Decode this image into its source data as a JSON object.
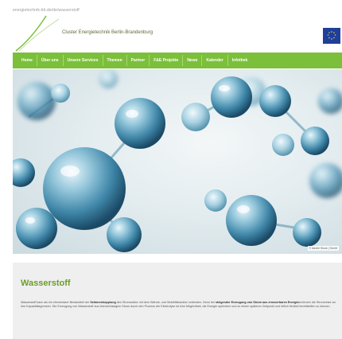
{
  "browser": {
    "url": "energietechnik-bb.de/de/wasserstoff"
  },
  "header": {
    "site_title": "Cluster Energietechnik Berlin-Brandenburg"
  },
  "nav": {
    "items": [
      "Home",
      "Über uns",
      "Unsere Services",
      "Themen",
      "Partner",
      "F&E Projekte",
      "News",
      "Kalender",
      "Infothek"
    ]
  },
  "hero": {
    "photo_credit": "© Adobe Stock | Sm4rt"
  },
  "page": {
    "title": "Wasserstoff",
    "paragraph_1": "Wasserstoff kann als ein elementarer Bestandteil der",
    "paragraph_1_bold": "Sektorenkopplung",
    "paragraph_2": "den Stromsektor mit dem Wärme- und Mobilitätssektor verbinden. Denn bei",
    "paragraph_2_bold": "steigender Erzeugung von Strom aus erneuerbaren Energien",
    "paragraph_3": "können die Stromnetze an ihre Kapazitätsgrenzen. Die Erzeugung von Wasserstoff aus überschüssigem Strom durch den Prozess der Elektrolyse ist eine Möglichkeit, die Energie speichern und zu einem späteren Zeitpunkt und örtlich flexibel bereitstellen zu können."
  },
  "colors": {
    "nav_green": "#7bbf3a",
    "title_green": "#6a9e2a",
    "eu_blue": "#1f3f9a"
  }
}
